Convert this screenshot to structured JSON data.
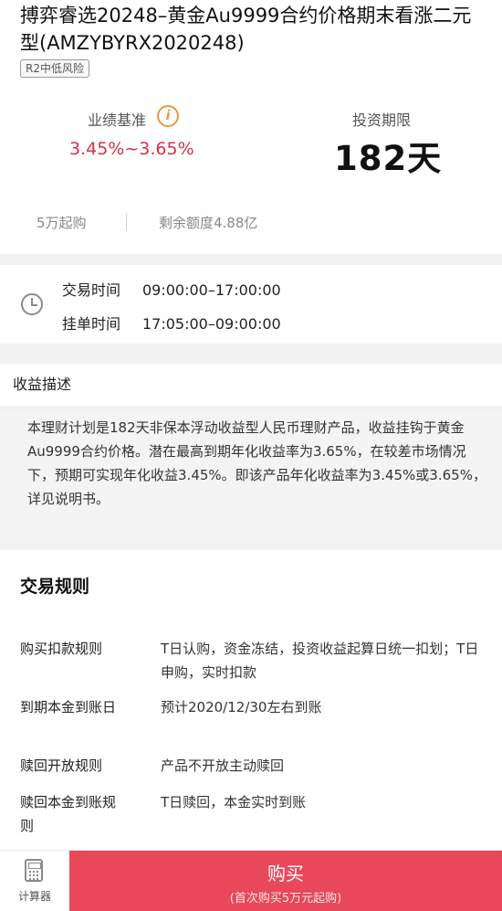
{
  "product": {
    "title": "搏弈睿选20248–黄金Au9999合约价格期末看涨二元型(AMZYBYRX2020248)",
    "risk_tag": "R2中低风险",
    "benchmark_label": "业绩基准",
    "benchmark_value": "3.45%~3.65%",
    "period_label": "投资期限",
    "period_value": "182天",
    "min_purchase": "5万起购",
    "remaining_quota": "剩余额度4.88亿"
  },
  "trade_time": {
    "trading_label": "交易时间",
    "trading_value": "09:00:00–17:00:00",
    "pending_label": "挂单时间",
    "pending_value": "17:05:00–09:00:00"
  },
  "yield": {
    "title": "收益描述",
    "text": "本理财计划是182天非保本浮动收益型人民币理财产品，收益挂钩于黄金Au9999合约价格。潜在最高到期年化收益率为3.65%，在较差市场情况下，预期可实现年化收益3.45%。即该产品年化收益率为3.45%或3.65%，详见说明书。"
  },
  "rules": {
    "title": "交易规则",
    "items": [
      {
        "label": "购买扣款规则",
        "value": "T日认购，资金冻结，投资收益起算日统一扣划；T日申购，实时扣款"
      },
      {
        "label": "到期本金到账日",
        "value": "预计2020/12/30左右到账"
      },
      {
        "label": "赎回开放规则",
        "value": "产品不开放主动赎回"
      },
      {
        "label": "赎回本金到账规则",
        "value": "T日赎回，本金实时到账"
      }
    ]
  },
  "bottom": {
    "calc_label": "计算器",
    "buy_label": "购买",
    "buy_sub": "(首次购买5万元起购)"
  },
  "colors": {
    "accent": "#e8485a",
    "rate": "#d9304a",
    "info_icon": "#e59a45"
  }
}
